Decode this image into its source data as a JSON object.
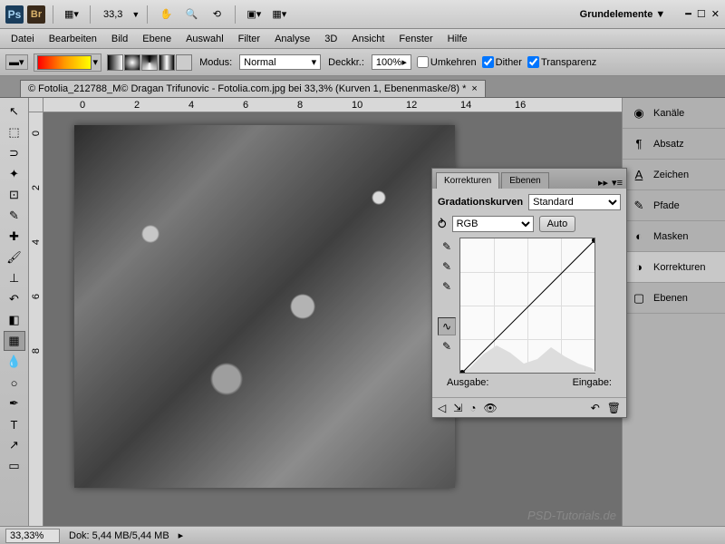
{
  "topbar": {
    "zoom": "33,3",
    "workspace": "Grundelemente"
  },
  "menu": [
    "Datei",
    "Bearbeiten",
    "Bild",
    "Ebene",
    "Auswahl",
    "Filter",
    "Analyse",
    "3D",
    "Ansicht",
    "Fenster",
    "Hilfe"
  ],
  "optbar": {
    "mode_lbl": "Modus:",
    "mode": "Normal",
    "opacity_lbl": "Deckkr.:",
    "opacity": "100%",
    "reverse": "Umkehren",
    "dither": "Dither",
    "transparency": "Transparenz"
  },
  "doc_title": "© Fotolia_212788_M© Dragan Trifunovic - Fotolia.com.jpg bei 33,3% (Kurven 1, Ebenenmaske/8) *",
  "ruler_h": [
    "0",
    "2",
    "4",
    "6",
    "8",
    "10",
    "12",
    "14",
    "16"
  ],
  "ruler_v": [
    "0",
    "2",
    "4",
    "6",
    "8"
  ],
  "dock": [
    {
      "icon": "◉",
      "label": "Kanäle"
    },
    {
      "icon": "¶",
      "label": "Absatz"
    },
    {
      "icon": "A",
      "label": "Zeichen"
    },
    {
      "icon": "✎",
      "label": "Pfade"
    },
    {
      "icon": "◐",
      "label": "Masken"
    },
    {
      "icon": "◑",
      "label": "Korrekturen"
    },
    {
      "icon": "▢",
      "label": "Ebenen"
    }
  ],
  "panel": {
    "tab1": "Korrekturen",
    "tab2": "Ebenen",
    "title": "Gradationskurven",
    "preset": "Standard",
    "channel": "RGB",
    "auto": "Auto",
    "output": "Ausgabe:",
    "input": "Eingabe:"
  },
  "status": {
    "zoom": "33,33%",
    "doc": "Dok: 5,44 MB/5,44 MB"
  },
  "watermark": "PSD-Tutorials.de"
}
